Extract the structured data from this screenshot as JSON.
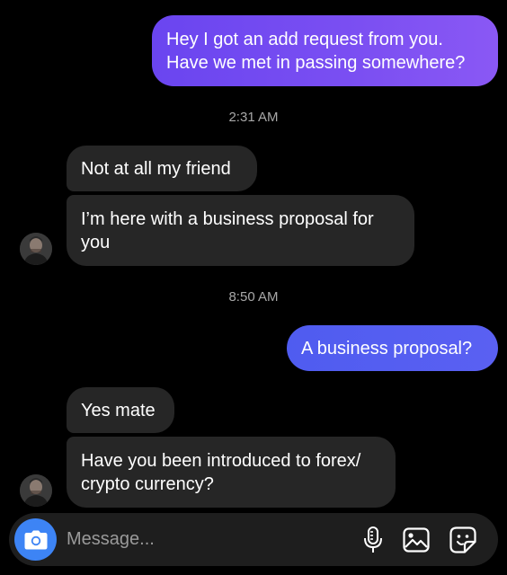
{
  "messages": [
    {
      "direction": "outgoing",
      "lines": [
        "Hey I got an add request from you.",
        "Have we met in passing somewhere?"
      ]
    },
    {
      "direction": "timestamp",
      "text": "2:31 AM"
    },
    {
      "direction": "incoming",
      "text": "Not at all my friend"
    },
    {
      "direction": "incoming",
      "lines": [
        "I’m here with a business proposal for",
        "you"
      ]
    },
    {
      "direction": "timestamp",
      "text": "8:50 AM"
    },
    {
      "direction": "outgoing",
      "text": "A business proposal?"
    },
    {
      "direction": "incoming",
      "text": "Yes mate"
    },
    {
      "direction": "incoming",
      "lines": [
        "Have you been introduced to forex/",
        "crypto currency?"
      ]
    }
  ],
  "composer": {
    "placeholder": "Message...",
    "value": ""
  },
  "icons": {
    "camera": "camera-icon",
    "microphone": "microphone-icon",
    "gallery": "gallery-icon",
    "sticker": "sticker-icon"
  },
  "colors": {
    "background": "#000000",
    "incoming_bubble": "#262626",
    "outgoing_bubble_purple": "#7b4ff2",
    "outgoing_bubble_blue": "#5a60f2",
    "camera_button": "#3d84f5",
    "timestamp_text": "#a8a8a8"
  }
}
